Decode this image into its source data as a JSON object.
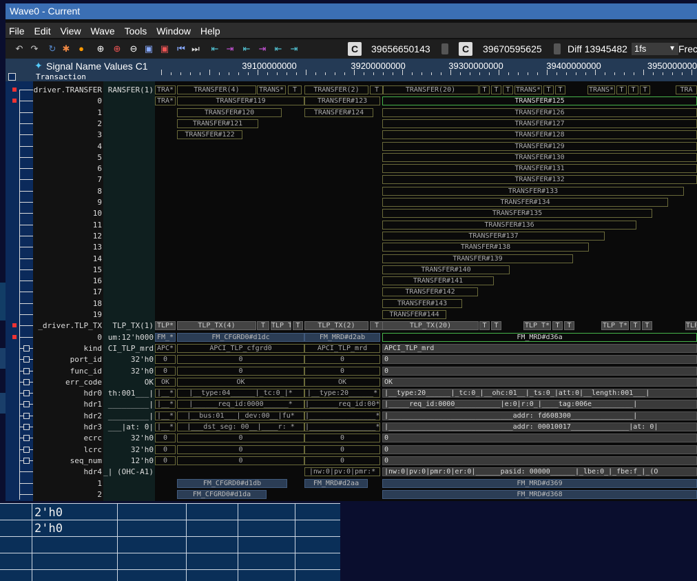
{
  "window": {
    "title": "Wave0 - Current"
  },
  "menu": [
    "File",
    "Edit",
    "View",
    "Wave",
    "Tools",
    "Window",
    "Help"
  ],
  "toolbar": {
    "cursor1_value": "39656650143",
    "cursor2_value": "39670595625",
    "diff_label": "Diff 13945482",
    "unit": "1fs",
    "freq_label": "Frec",
    "icons": [
      "undo-icon",
      "redo-icon",
      "reload-icon",
      "color-icon",
      "record-icon",
      "zoom-in-icon",
      "zoom-in-alt-icon",
      "zoom-out-icon",
      "zoom-fit-icon",
      "zoom-cursor-icon",
      "first-icon",
      "last-icon",
      "prev-edge-icon",
      "next-edge-icon",
      "prev-rise-icon",
      "next-rise-icon",
      "prev-fall-icon",
      "next-fall-icon"
    ]
  },
  "header": {
    "columns_label": "Signal Name Values C1",
    "ruler": [
      "39100000000",
      "39200000000",
      "39300000000",
      "39400000000",
      "3950000000"
    ],
    "transaction_label": "Transaction"
  },
  "signals": [
    {
      "name": "driver.TRANSFER",
      "value": "RANSFER(1)"
    },
    {
      "name": "0",
      "value": ""
    },
    {
      "name": "1",
      "value": ""
    },
    {
      "name": "2",
      "value": ""
    },
    {
      "name": "3",
      "value": ""
    },
    {
      "name": "4",
      "value": ""
    },
    {
      "name": "5",
      "value": ""
    },
    {
      "name": "6",
      "value": ""
    },
    {
      "name": "7",
      "value": ""
    },
    {
      "name": "8",
      "value": ""
    },
    {
      "name": "9",
      "value": ""
    },
    {
      "name": "10",
      "value": ""
    },
    {
      "name": "11",
      "value": ""
    },
    {
      "name": "12",
      "value": ""
    },
    {
      "name": "13",
      "value": ""
    },
    {
      "name": "14",
      "value": ""
    },
    {
      "name": "15",
      "value": ""
    },
    {
      "name": "16",
      "value": ""
    },
    {
      "name": "17",
      "value": ""
    },
    {
      "name": "18",
      "value": ""
    },
    {
      "name": "19",
      "value": ""
    },
    {
      "name": "_driver.TLP_TX",
      "value": "TLP_TX(1)"
    },
    {
      "name": "0",
      "value": "um:12'h000"
    },
    {
      "name": "kind",
      "value": "CI_TLP_mrd"
    },
    {
      "name": "port_id",
      "value": "32'h0"
    },
    {
      "name": "func_id",
      "value": "32'h0"
    },
    {
      "name": "err_code",
      "value": "OK"
    },
    {
      "name": "hdr0",
      "value": "th:001___|"
    },
    {
      "name": "hdr1",
      "value": "_________|"
    },
    {
      "name": "hdr2",
      "value": "_________|"
    },
    {
      "name": "hdr3",
      "value": "___|at: 0|"
    },
    {
      "name": "ecrc",
      "value": "32'h0"
    },
    {
      "name": "lcrc",
      "value": "32'h0"
    },
    {
      "name": "seq_num",
      "value": "12'h0"
    },
    {
      "name": "hdr4",
      "value": "_| (OHC-A1)"
    },
    {
      "name": "1",
      "value": ""
    },
    {
      "name": "2",
      "value": ""
    }
  ],
  "wave": {
    "row0": [
      "TRA*",
      "TRANSFER(4)",
      "TRANS*",
      "T",
      "TRANSFER(2)",
      "T",
      "TRANSFER(20)",
      "T",
      "T",
      "T",
      "TRANS*",
      "T",
      "T",
      "TRANS*",
      "T",
      "T",
      "T",
      "TRA"
    ],
    "sub0": [
      "TRA*",
      "TRANSFER#119",
      "TRANSFER#123",
      "TRANSFER#125"
    ],
    "sub1": [
      "TRANSFER#120",
      "TRANSFER#124",
      "TRANSFER#126"
    ],
    "sub2": [
      "TRANSFER#121",
      "TRANSFER#127"
    ],
    "sub3": [
      "TRANSFER#122",
      "TRANSFER#128"
    ],
    "transfers": [
      "TRANSFER#129",
      "TRANSFER#130",
      "TRANSFER#131",
      "TRANSFER#132",
      "TRANSFER#133",
      "TRANSFER#134",
      "TRANSFER#135",
      "TRANSFER#136",
      "TRANSFER#137",
      "TRANSFER#138",
      "TRANSFER#139",
      "TRANSFER#140",
      "TRANSFER#141",
      "TRANSFER#142",
      "TRANSFER#143",
      "TRANSFER#144"
    ],
    "tlp_row": [
      "TLP*",
      "TLP_TX(4)",
      "T",
      "TLP T*",
      "T",
      "TLP_TX(2)",
      "T",
      "TLP_TX(20)",
      "T",
      "T",
      "TLP T*",
      "T",
      "T",
      "TLP T*",
      "T",
      "T",
      "TLP"
    ],
    "tlp0": [
      "FM_*",
      "FM_CFGRD0#d1dc",
      "FM_MRD#d2ab",
      "FM_MRD#d36a"
    ],
    "kind": [
      "APC*",
      "APCI_TLP_cfgrd0",
      "APCI_TLP_mrd",
      "APCI_TLP_mrd"
    ],
    "port_id": [
      "0",
      "0",
      "0",
      "0"
    ],
    "func_id": [
      "0",
      "0",
      "0",
      "0"
    ],
    "err_code": [
      "OK",
      "OK",
      "OK",
      "OK"
    ],
    "hdr0": [
      "|__*",
      "|__type:04______|_tc:0_|*",
      "|__type:20______*",
      "|__type:20______|_tc:0_|__ohc:01__|_ts:0_|att:0|__length:001___|"
    ],
    "hdr1": [
      "|__*",
      "|______req_id:0000______*",
      "|_______req_id:00*",
      "|_____req_id:0000___________|e:0|r:0_|____tag:006e__________|"
    ],
    "hdr2": [
      "|__*",
      "|__bus:01___|_dev:00__|fu*",
      "|________________*",
      "|______________________________addr: fd608300_______________|"
    ],
    "hdr3": [
      "|__*",
      "|___dst_seg: 00__|____r: *",
      "|________________*",
      "|______________________________addr: 00010017______________|at: 0|"
    ],
    "ecrc": [
      "0",
      "0",
      "0",
      "0"
    ],
    "lcrc": [
      "0",
      "0",
      "0",
      "0"
    ],
    "seq_num": [
      "0",
      "0",
      "0",
      "0"
    ],
    "hdr4": [
      "|nw:0|pv:0|pmr:*",
      "|nw:0|pv:0|pmr:0|er:0|______pasid: 00000______|_lbe:0_|_fbe:f_|_(O"
    ],
    "tlp1": [
      "FM_CFGRD0#d1db",
      "FM_MRD#d2aa",
      "FM_MRD#d369"
    ],
    "tlp2": [
      "FM_CFGRD0#d1da",
      "FM_MRD#d368"
    ]
  },
  "background": {
    "values": [
      "2'h0",
      "2'h0"
    ]
  }
}
